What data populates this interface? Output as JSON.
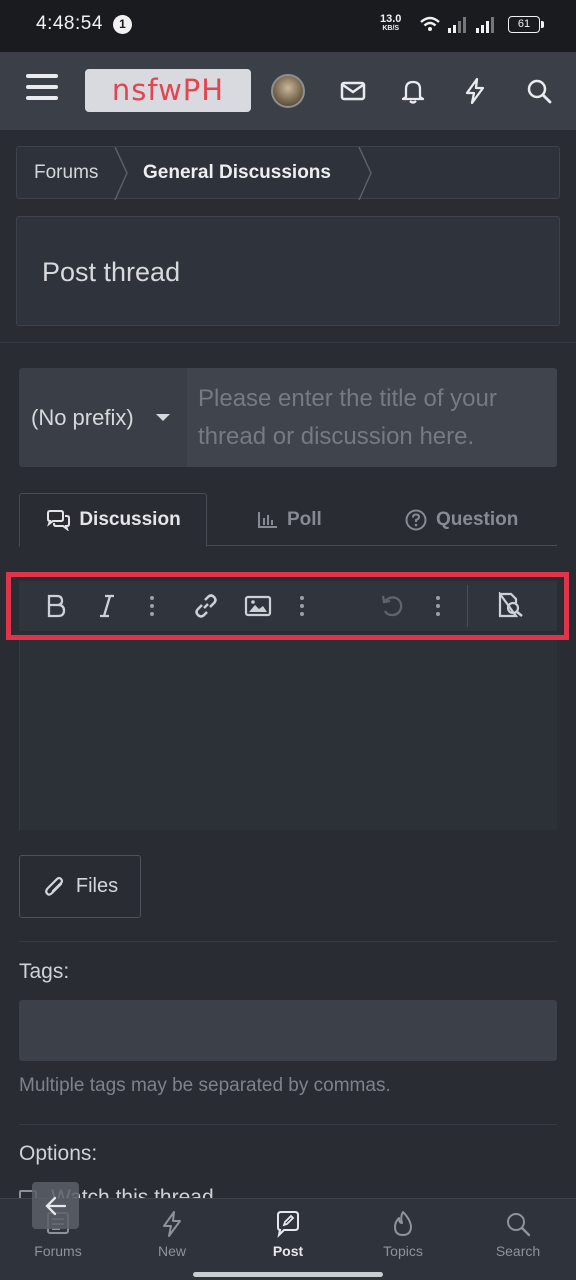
{
  "status_bar": {
    "time": "4:48:54",
    "notification_count": "1",
    "net_speed_value": "13.0",
    "net_speed_unit": "KB/S",
    "battery": "61"
  },
  "header": {
    "logo": "nsfwPH",
    "icons": [
      "menu-icon",
      "avatar",
      "mail-icon",
      "bell-icon",
      "bolt-icon",
      "search-icon"
    ]
  },
  "breadcrumb": {
    "items": [
      "Forums",
      "General Discussions"
    ]
  },
  "page": {
    "title": "Post thread"
  },
  "form": {
    "prefix_selected": "(No prefix)",
    "title_placeholder": "Please enter the title of your thread or discussion here.",
    "tabs": [
      {
        "label": "Discussion",
        "icon": "comments-icon",
        "active": true
      },
      {
        "label": "Poll",
        "icon": "chart-icon",
        "active": false
      },
      {
        "label": "Question",
        "icon": "question-circle-icon",
        "active": false
      }
    ],
    "toolbar": [
      "bold-icon",
      "italic-icon",
      "more-icon",
      "link-icon",
      "image-icon",
      "more-icon",
      "undo-icon",
      "more-icon",
      "preview-icon"
    ],
    "files_label": "Files",
    "tags_label": "Tags:",
    "tags_hint": "Multiple tags may be separated by commas.",
    "options_label": "Options:",
    "watch_label": "Watch this thread"
  },
  "bottom_nav": {
    "items": [
      {
        "label": "Forums",
        "icon": "forums-icon",
        "active": false
      },
      {
        "label": "New",
        "icon": "bolt-icon",
        "active": false
      },
      {
        "label": "Post",
        "icon": "post-icon",
        "active": true
      },
      {
        "label": "Topics",
        "icon": "fire-icon",
        "active": false
      },
      {
        "label": "Search",
        "icon": "search-icon",
        "active": false
      }
    ]
  },
  "colors": {
    "highlight": "#e1334a",
    "logo_text": "#e2454f",
    "background": "#292c33",
    "header": "#3a3f48"
  }
}
